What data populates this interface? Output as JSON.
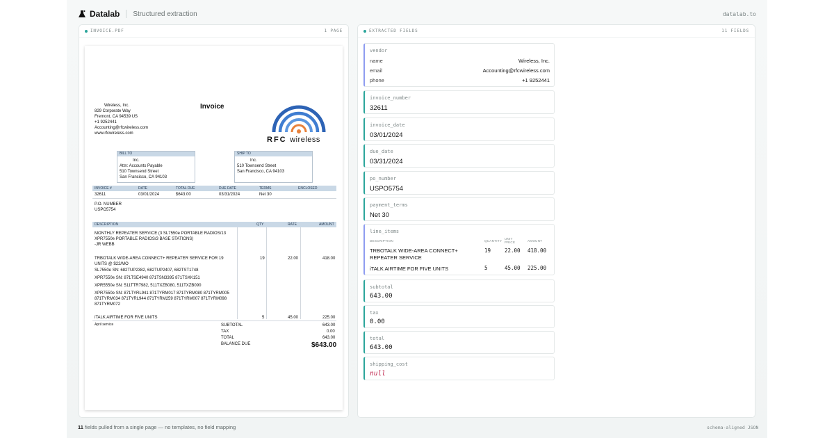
{
  "app": {
    "name": "Datalab",
    "subtitle": "Structured extraction",
    "link": "datalab.to"
  },
  "left_panel": {
    "title": "INVOICE.PDF",
    "pages": "1 PAGE"
  },
  "right_panel": {
    "title": "EXTRACTED FIELDS",
    "count": "11 FIELDS"
  },
  "invoice": {
    "title": "Invoice",
    "sender_lines": [
      "Wireless, Inc.",
      "829 Corporate Way",
      "Fremont, CA  94539 US",
      "+1 9252441",
      "Accounting@rfcwireless.com",
      "www.rfcwireless.com"
    ],
    "logo_bold": "RFC",
    "logo_light": "wireless",
    "bill_to_label": "BILL TO",
    "bill_to_lines": [
      "Inc.",
      "Attn:  Accounts Payable",
      "510 Townsend Street",
      "San Francisco, CA 94103"
    ],
    "ship_to_label": "SHIP TO",
    "ship_to_lines": [
      "Inc.",
      "510 Townsend Street",
      "San Francisco, CA 94103"
    ],
    "meta_headers": [
      "INVOICE #",
      "DATE",
      "TOTAL DUE",
      "DUE DATE",
      "TERMS",
      "ENCLOSED"
    ],
    "meta_values": [
      "32611",
      "03/01/2024",
      "$643.00",
      "03/31/2024",
      "Net 30",
      ""
    ],
    "po_label": "P.O. NUMBER",
    "po_value": "USPO5754",
    "item_headers": [
      "DESCRIPTION",
      "QTY",
      "RATE",
      "AMOUNT"
    ],
    "desc1": [
      "MONTHLY REPEATER SERVICE (3 SL7550e PORTABLE RADIOS/13",
      "XPR7550e PORTABLE RADIOS/3 BASE STATIONS)",
      "-JR WEBB"
    ],
    "desc2": [
      "TRBOTALK WIDE-AREA CONNECT+ REPEATER SERVICE FOR 19",
      "UNITS @ $22/MO"
    ],
    "item2_qty": "19",
    "item2_rate": "22.00",
    "item2_amount": "418.00",
    "serial1": "SL7550e SN: 682TUP2382, 682TUP2407, 682TST1748",
    "serial2": "XPR7550e SN: 871TSE4940 871TSN3395 871TSXK151",
    "serial3": "XPR5550e SN: 511TTR7982, 511TXZB080, 511TXZB090",
    "serial4": [
      "XPR7550e SN: 871TYRL941 871TYRM017 871TYRM080 871TYRM005",
      "871TYRM034 871TYRL944 871TYRM259 871TYRM007 871TYRM098",
      "871TYRM072"
    ],
    "item3_desc": "iTALK AIRTIME FOR FIVE UNITS",
    "item3_qty": "5",
    "item3_rate": "45.00",
    "item3_amount": "225.00",
    "april": "April service",
    "subtotal_label": "SUBTOTAL",
    "subtotal": "643.00",
    "tax_label": "TAX",
    "tax": "0.00",
    "total_label": "TOTAL",
    "total": "643.00",
    "balance_label": "BALANCE DUE",
    "balance": "$643.00"
  },
  "fields": {
    "vendor": {
      "key": "vendor",
      "name_k": "name",
      "name_v": "Wireless, Inc.",
      "email_k": "email",
      "email_v": "Accounting@rfcwireless.com",
      "phone_k": "phone",
      "phone_v": "+1 9252441"
    },
    "invoice_number": {
      "key": "invoice_number",
      "value": "32611"
    },
    "invoice_date": {
      "key": "invoice_date",
      "value": "03/01/2024"
    },
    "due_date": {
      "key": "due_date",
      "value": "03/31/2024"
    },
    "po_number": {
      "key": "po_number",
      "value": "USPO5754"
    },
    "payment_terms": {
      "key": "payment_terms",
      "value": "Net 30"
    },
    "line_items": {
      "key": "line_items",
      "h_desc": "DESCRIPTION",
      "h_qty": "QUANTITY",
      "h_unit1": "UNIT",
      "h_unit2": "PRICE",
      "h_amount": "AMOUNT",
      "r1_desc1": "TRBOTALK WIDE-AREA CONNECT+",
      "r1_desc2": "REPEATER SERVICE",
      "r1_qty": "19",
      "r1_price": "22.00",
      "r1_amount": "418.00",
      "r2_desc": "iTALK AIRTIME FOR FIVE UNITS",
      "r2_qty": "5",
      "r2_price": "45.00",
      "r2_amount": "225.00"
    },
    "subtotal": {
      "key": "subtotal",
      "value": "643.00"
    },
    "tax": {
      "key": "tax",
      "value": "0.00"
    },
    "total": {
      "key": "total",
      "value": "643.00"
    },
    "shipping_cost": {
      "key": "shipping_cost",
      "value": "null"
    }
  },
  "footer": {
    "count": "11",
    "text": " fields pulled from a single page — no templates, no field mapping",
    "right": "schema-aligned JSON"
  },
  "colors": {
    "accent": "#2ba59b",
    "group_accent": "#8e9cf0",
    "null": "#c0284f"
  }
}
